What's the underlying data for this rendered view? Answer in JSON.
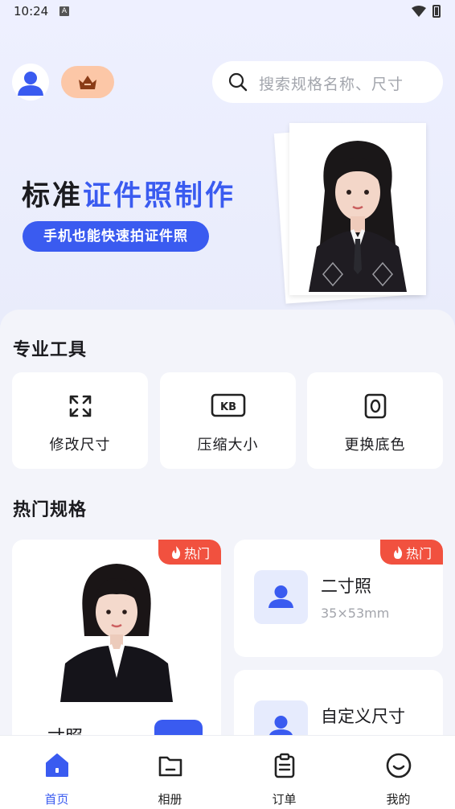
{
  "status": {
    "time": "10:24",
    "indicator": "A"
  },
  "search": {
    "placeholder": "搜索规格名称、尺寸"
  },
  "banner": {
    "title_dark": "标准",
    "title_blue": "证件照制作",
    "subtitle": "手机也能快速拍证件照"
  },
  "tools": {
    "title": "专业工具",
    "items": [
      {
        "label": "修改尺寸",
        "icon": "resize-icon"
      },
      {
        "label": "压缩大小",
        "icon": "kb-icon"
      },
      {
        "label": "更换底色",
        "icon": "background-color-icon"
      }
    ]
  },
  "specs": {
    "title": "热门规格",
    "hot_label": "热门",
    "big": {
      "name": "一寸照"
    },
    "items": [
      {
        "name": "二寸照",
        "size": "35×53mm",
        "hot": true
      },
      {
        "name": "自定义尺寸",
        "size": "",
        "hot": false
      }
    ]
  },
  "tabs": [
    {
      "label": "首页",
      "icon": "home-icon",
      "active": true
    },
    {
      "label": "相册",
      "icon": "folder-icon",
      "active": false
    },
    {
      "label": "订单",
      "icon": "clipboard-icon",
      "active": false
    },
    {
      "label": "我的",
      "icon": "smile-icon",
      "active": false
    }
  ],
  "colors": {
    "accent": "#3a5bf0",
    "hot": "#f1513f",
    "crown_bg": "#fcc7a7"
  }
}
